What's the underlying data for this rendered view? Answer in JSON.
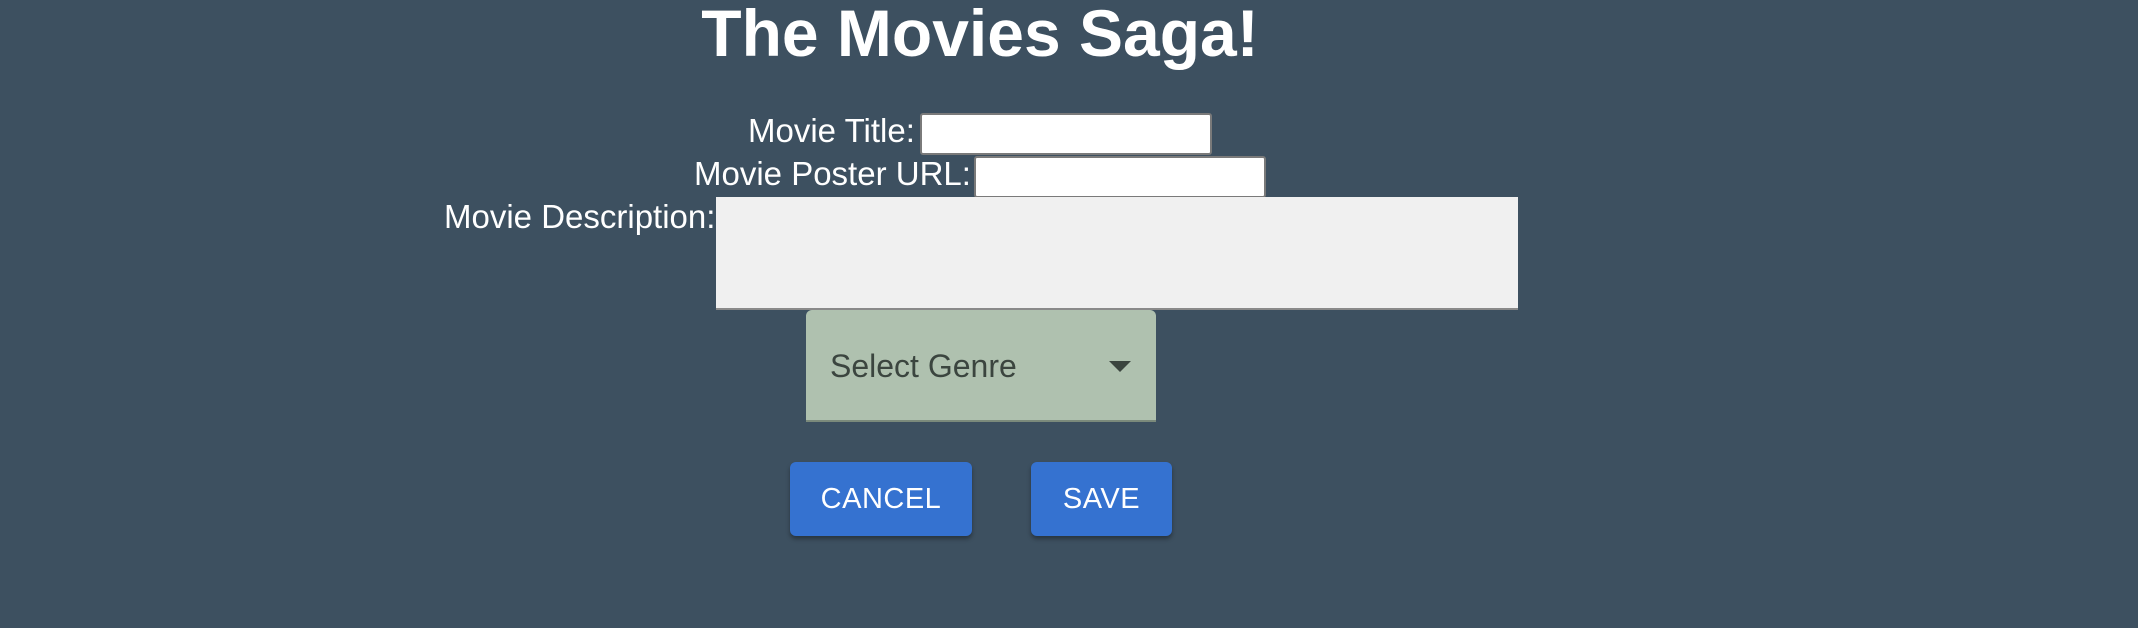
{
  "page": {
    "title": "The Movies Saga!"
  },
  "form": {
    "movie_title": {
      "label": "Movie Title:",
      "value": ""
    },
    "poster_url": {
      "label": "Movie Poster URL:",
      "value": ""
    },
    "description": {
      "label": "Movie Description:",
      "value": ""
    },
    "genre": {
      "placeholder": "Select Genre",
      "icon": "chevron-down-icon"
    }
  },
  "actions": {
    "cancel_label": "CANCEL",
    "save_label": "SAVE"
  },
  "colors": {
    "background": "#3d5060",
    "button": "#3572d0",
    "select_background": "#afc1af",
    "textarea_background": "#f0f0f0"
  }
}
